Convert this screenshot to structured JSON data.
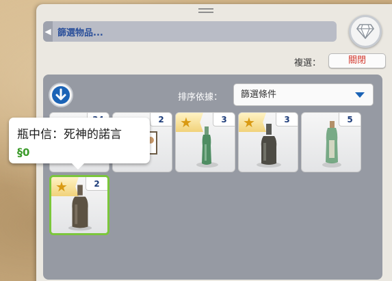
{
  "header": {
    "filter_label": "篩選物品..."
  },
  "toolbar": {
    "multi_label": "複選：",
    "close_label": "關閉"
  },
  "sort": {
    "label": "排序依據：",
    "selected": "篩選條件"
  },
  "items": [
    {
      "count": "34",
      "starred": false
    },
    {
      "count": "2",
      "starred": false
    },
    {
      "count": "3",
      "starred": true
    },
    {
      "count": "3",
      "starred": true
    },
    {
      "count": "5",
      "starred": false
    },
    {
      "count": "2",
      "starred": true
    }
  ],
  "tooltip": {
    "title": "瓶中信：死神的諾言",
    "currency_symbol": "§",
    "price": "0"
  },
  "colors": {
    "accent": "#1b63b6",
    "close_text": "#d33a2f",
    "selected_border": "#7bc63b",
    "price": "#3b9b2a"
  }
}
